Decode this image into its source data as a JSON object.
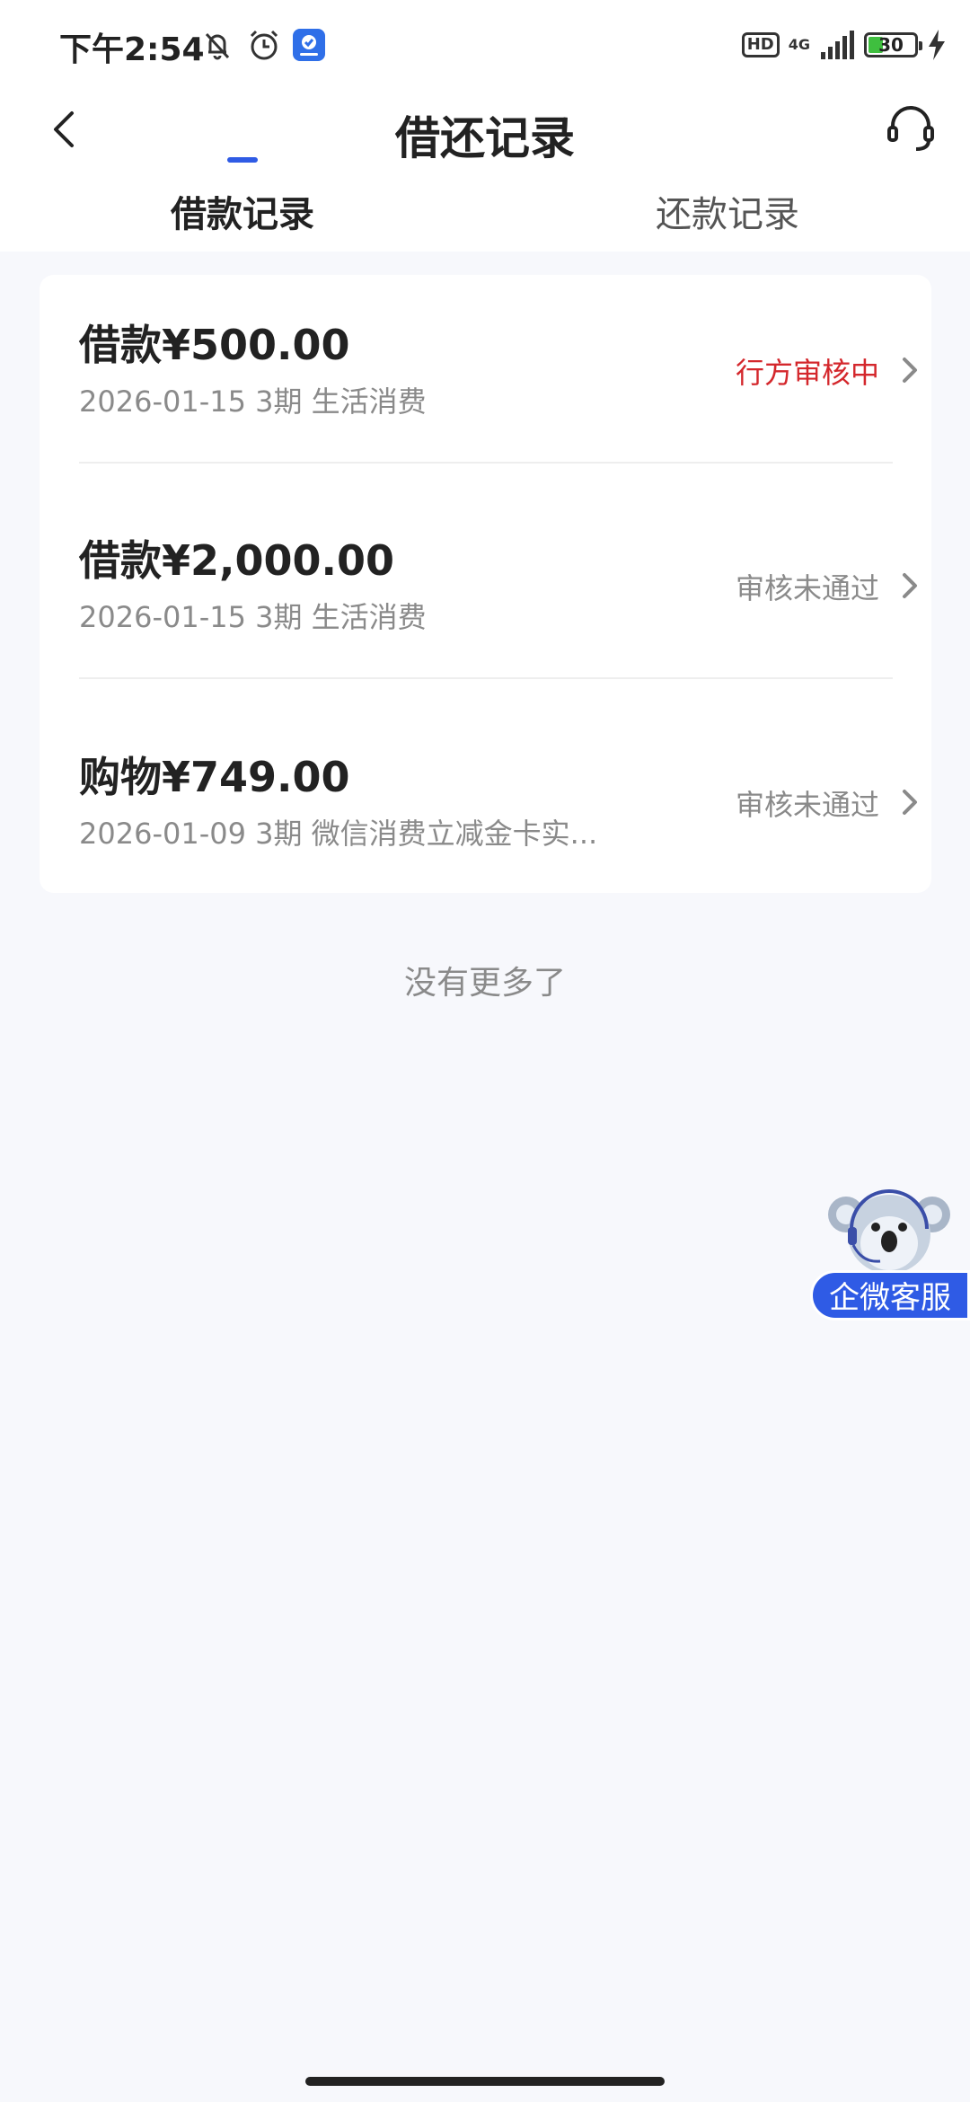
{
  "status_bar": {
    "time": "下午2:54",
    "hd": "HD",
    "network": "4G",
    "battery": "30"
  },
  "header": {
    "title": "借还记录"
  },
  "tabs": [
    {
      "label": "借款记录"
    },
    {
      "label": "还款记录"
    }
  ],
  "records": [
    {
      "amount": "借款¥500.00",
      "meta": "2026-01-15 3期  生活消费",
      "status": "行方审核中",
      "status_color": "#d4272c"
    },
    {
      "amount": "借款¥2,000.00",
      "meta": "2026-01-15 3期  生活消费",
      "status": "审核未通过",
      "status_color": "#8a8a8a"
    },
    {
      "amount": "购物¥749.00",
      "meta": "2026-01-09 3期  微信消费立减金卡实...",
      "status": "审核未通过",
      "status_color": "#8a8a8a"
    }
  ],
  "list_end_text": "没有更多了",
  "floating_service": {
    "label": "企微客服"
  },
  "colors": {
    "accent": "#2f5be5",
    "status_red": "#d4272c"
  }
}
